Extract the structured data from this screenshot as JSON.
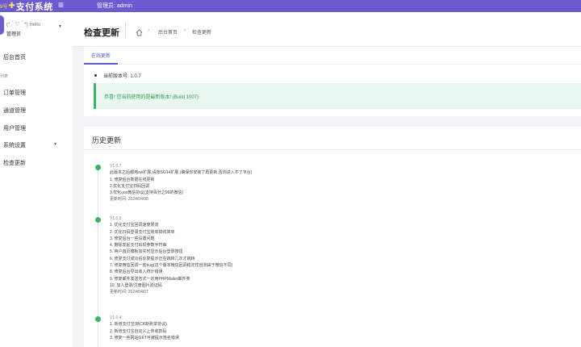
{
  "colors": {
    "brand": "#6a5bd0",
    "accent": "#5b5bd6",
    "success": "#3fb36c"
  },
  "brand": {
    "prefix": "9号",
    "name": "支付系统",
    "menu_icon": "menu-icon"
  },
  "topbar": {
    "admin_label": "管理员: admin"
  },
  "user": {
    "greeting": "(*＾▽＾*) Hello",
    "role": "管理员"
  },
  "sidebar": {
    "home": "后台首页",
    "group": "列表",
    "items": [
      "订单管理",
      "通道管理",
      "用户管理",
      "系统设置",
      "检查更新"
    ]
  },
  "header": {
    "title": "检查更新",
    "breadcrumb": [
      "后台首页",
      "检查更新"
    ],
    "home_icon": "home-icon"
  },
  "online": {
    "tab": "在线更新",
    "current_version": "当前版本号: 1.0.7",
    "notice": "恭喜! 您当前使用的是最新版本! (Build 1007)"
  },
  "history": {
    "title": "历史更新",
    "entries": [
      {
        "version": "V1.0.7",
        "lines": [
          "此版本之后都用sw扩展,请按SG14扩展 (确保你安装了再更新,否则进入不了平台)",
          "1. 修复后台数据在线更新",
          "2.优化支付宝扫码回调",
          "3.优化uos微信协议(支持百分之99的微信)"
        ],
        "time": "更新时间: 2024/04/08"
      },
      {
        "version": "V1.0.5",
        "lines": [
          "1. 优化支付宝回调速度限流",
          "2. 优化扫码登录支付宝账单掉线简单",
          "3. 修复后台一些设置问题",
          "4. 删除发起支付出现参数字符串",
          "5. 用户首页模板加实时显示后台登录按钮",
          "6. 修复支付成功后反复提示正在跳转几次才跳转",
          "7. 修复微信回调一些bug(这个版本微信回调稳定性自测由于微信不同)",
          "8. 修复后台导出收入统计错误",
          "9. 修复邮件发送方式一次用PHPMailer邮件类",
          "10. 加入登录/注册图片验证码"
        ],
        "time": "更新时间: 2024/04/07"
      },
      {
        "version": "V1.0.4",
        "lines": [
          "1. 新增支付宝(新CK新账单协议)",
          "2. 新增支付宝自定义上传收款码",
          "3. 修复一些网站GET可被提示签名错误"
        ],
        "time": ""
      }
    ]
  }
}
